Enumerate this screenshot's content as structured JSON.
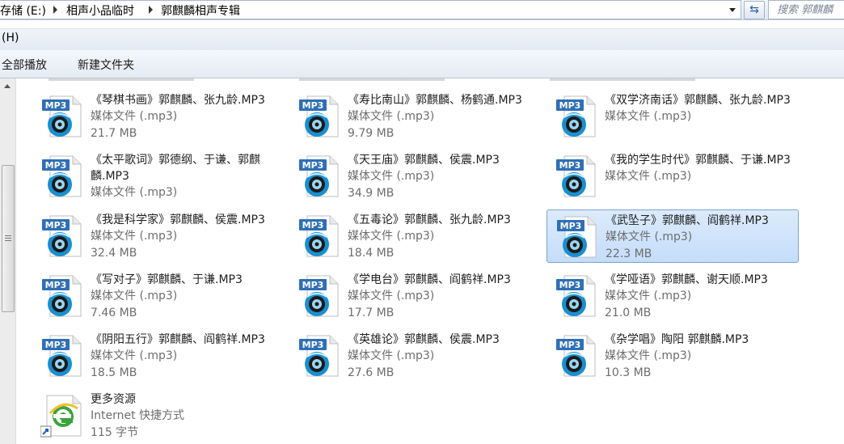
{
  "address_bar": {
    "crumbs": [
      "存储 (E:)",
      "相声小品临时",
      "郭麒麟相声专辑"
    ],
    "search_placeholder": "搜索 郭麒麟"
  },
  "menu": {
    "items": [
      "(H)"
    ]
  },
  "command_bar": {
    "play_all": "全部播放",
    "new_folder": "新建文件夹"
  },
  "icons": {
    "mp3": "mp3-file-icon",
    "internet_shortcut": "ie-shortcut-icon",
    "mp3_badge_text": "MP3",
    "accent_blue": "#1a8fd0",
    "badge_blue": "#2f6fb7"
  },
  "files": [
    {
      "name": "《琴棋书画》郭麒麟、张九龄.MP3",
      "type": "媒体文件 (.mp3)",
      "size": "21.7 MB"
    },
    {
      "name": "《寿比南山》郭麒麟、杨鹤通.MP3",
      "type": "媒体文件 (.mp3)",
      "size": "9.79 MB"
    },
    {
      "name": "《双学济南话》郭麒麟、张九龄.MP3",
      "type": "媒体文件 (.mp3)",
      "size": ""
    },
    {
      "name": "《太平歌词》郭德纲、于谦、郭麒麟.MP3",
      "type": "媒体文件 (.mp3)",
      "size": ""
    },
    {
      "name": "《天王庙》郭麒麟、侯震.MP3",
      "type": "媒体文件 (.mp3)",
      "size": "34.9 MB"
    },
    {
      "name": "《我的学生时代》郭麒麟、于谦.MP3",
      "type": "媒体文件 (.mp3)",
      "size": ""
    },
    {
      "name": "《我是科学家》郭麒麟、侯震.MP3",
      "type": "媒体文件 (.mp3)",
      "size": "32.4 MB"
    },
    {
      "name": "《五毒论》郭麒麟、张九龄.MP3",
      "type": "媒体文件 (.mp3)",
      "size": "18.4 MB"
    },
    {
      "name": "《武坠子》郭麒麟、阎鹤祥.MP3",
      "type": "媒体文件 (.mp3)",
      "size": "22.3 MB",
      "selected": true
    },
    {
      "name": "《写对子》郭麒麟、于谦.MP3",
      "type": "媒体文件 (.mp3)",
      "size": "7.46 MB"
    },
    {
      "name": "《学电台》郭麒麟、阎鹤祥.MP3",
      "type": "媒体文件 (.mp3)",
      "size": "17.7 MB"
    },
    {
      "name": "《学哑语》郭麒麟、谢天顺.MP3",
      "type": "媒体文件 (.mp3)",
      "size": "21.0 MB"
    },
    {
      "name": "《阴阳五行》郭麒麟、阎鹤祥.MP3",
      "type": "媒体文件 (.mp3)",
      "size": "18.5 MB"
    },
    {
      "name": "《英雄论》郭麒麟、侯震.MP3",
      "type": "媒体文件 (.mp3)",
      "size": "27.6 MB"
    },
    {
      "name": "《杂学唱》陶阳 郭麒麟.MP3",
      "type": "媒体文件 (.mp3)",
      "size": "10.3 MB"
    },
    {
      "name": "更多资源",
      "type": "Internet 快捷方式",
      "size": "115 字节",
      "kind": "shortcut"
    }
  ]
}
